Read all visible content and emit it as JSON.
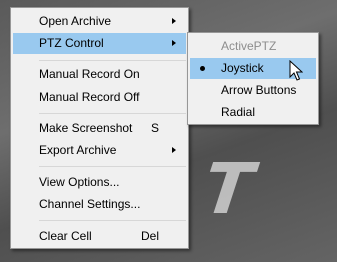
{
  "main_menu": {
    "items": [
      {
        "label": "Open Archive",
        "has_submenu": true
      },
      {
        "label": "PTZ Control",
        "has_submenu": true,
        "highlighted": true
      },
      {
        "label": "Manual Record On"
      },
      {
        "label": "Manual Record Off"
      },
      {
        "label": "Make Screenshot",
        "shortcut": "S"
      },
      {
        "label": "Export Archive",
        "has_submenu": true
      },
      {
        "label": "View Options..."
      },
      {
        "label": "Channel Settings..."
      },
      {
        "label": "Clear Cell",
        "shortcut": "Del"
      }
    ]
  },
  "submenu": {
    "items": [
      {
        "label": "ActivePTZ",
        "disabled": true
      },
      {
        "label": "Joystick",
        "selected": true,
        "highlighted": true
      },
      {
        "label": "Arrow Buttons"
      },
      {
        "label": "Radial"
      }
    ]
  },
  "colors": {
    "menu_bg": "#f0f0f0",
    "highlight": "#99c9ef",
    "disabled_text": "#8d8d8d"
  }
}
